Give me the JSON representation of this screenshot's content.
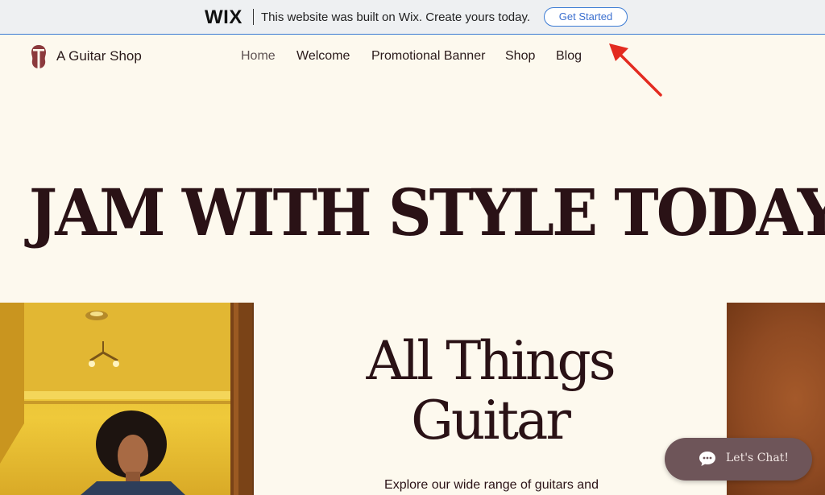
{
  "wix_banner": {
    "logo": "WIX",
    "message": "This website was built on Wix. Create yours today.",
    "cta_label": "Get Started"
  },
  "header": {
    "brand_name": "A Guitar Shop",
    "nav": [
      {
        "label": "Home"
      },
      {
        "label": "Welcome"
      },
      {
        "label": "Promotional Banner"
      },
      {
        "label": "Shop"
      },
      {
        "label": "Blog"
      }
    ]
  },
  "hero": {
    "headline": "JAM WITH STYLE TODAY!"
  },
  "section": {
    "title_line1": "All Things",
    "title_line2": "Guitar",
    "description": "Explore our wide range of guitars and"
  },
  "chat": {
    "label": "Let's Chat!"
  },
  "colors": {
    "background": "#fdf9ee",
    "text": "#2a1216",
    "wix_accent": "#3b7bd4",
    "chat_bg": "#6e5559",
    "arrow": "#e32b20"
  }
}
